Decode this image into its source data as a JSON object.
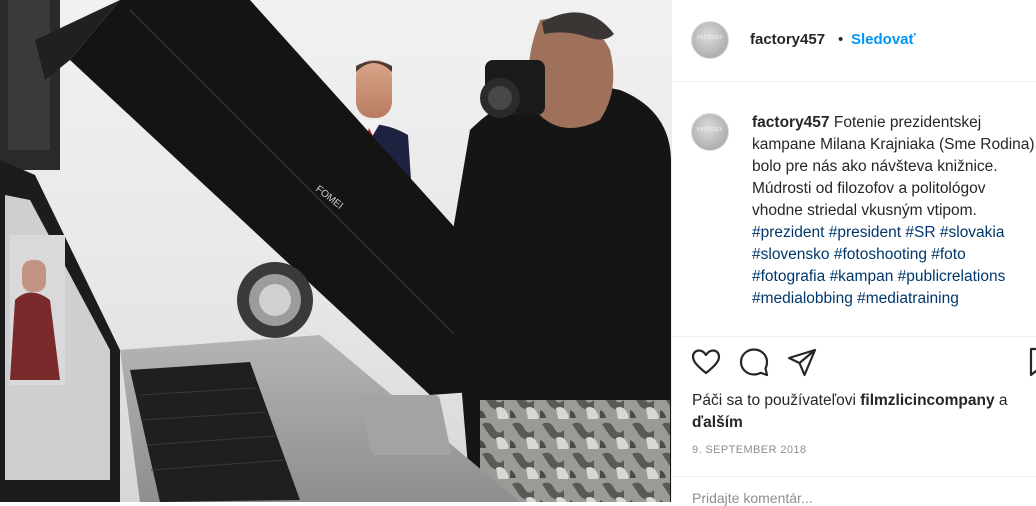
{
  "post": {
    "username": "factory457",
    "avatar_text": "FACTORY",
    "separator": "•",
    "follow_label": "Sledovať",
    "caption_username": "factory457",
    "caption": "Fotenie prezidentskej kampane Milana Krajniaka (Sme Rodina) bolo pre nás ako návšteva knižnice. Múdrosti od filozofov a politológov vhodne striedal vkusným vtipom.",
    "hashtags": [
      "#prezident",
      "#president",
      "#SR",
      "#slovakia",
      "#slovensko",
      "#fotoshooting",
      "#foto",
      "#fotografia",
      "#kampan",
      "#publicrelations",
      "#medialobbing",
      "#mediatraining"
    ],
    "likes": {
      "prefix": "Páči sa to používateľovi",
      "user": "filmzlicincompany",
      "suffix_a": "a",
      "suffix_b": "ďalším"
    },
    "date": "9. SEPTEMBER 2018",
    "add_comment_placeholder": "Pridajte komentár..."
  },
  "photo": {
    "softbox_brand": "FOMEI"
  },
  "icons": {
    "like": "heart-outline-icon",
    "comment": "comment-bubble-icon",
    "share": "paper-plane-icon",
    "save": "bookmark-icon"
  },
  "colors": {
    "link_blue": "#0095f6",
    "hashtag": "#00376b",
    "muted": "#8e8e8e",
    "text": "#262626"
  }
}
